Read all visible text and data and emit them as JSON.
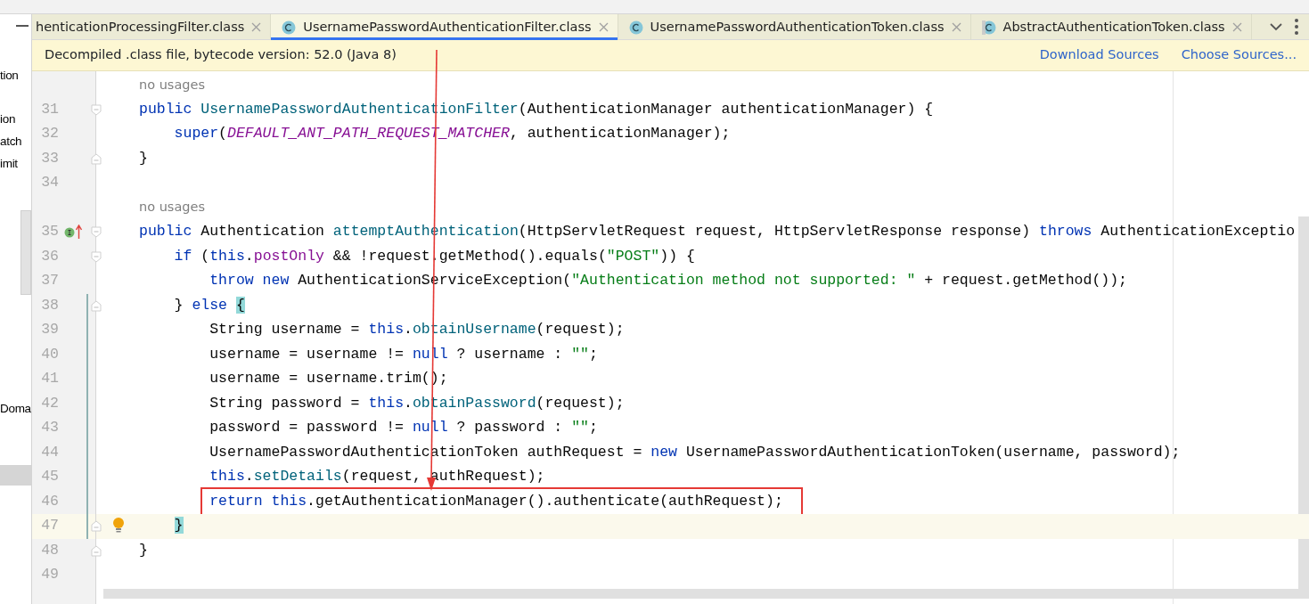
{
  "project_tree": [
    {
      "label": "tion",
      "selected": false
    },
    {
      "label": "ion",
      "selected": false
    },
    {
      "label": "atch",
      "selected": false
    },
    {
      "label": "imit",
      "selected": false
    },
    {
      "label": "Doma",
      "selected": false
    }
  ],
  "tabs": [
    {
      "label": "henticationProcessingFilter.class",
      "selected": false,
      "kind": "partial"
    },
    {
      "label": "UsernamePasswordAuthenticationFilter.class",
      "selected": true,
      "kind": "class"
    },
    {
      "label": "UsernamePasswordAuthenticationToken.class",
      "selected": false,
      "kind": "class"
    },
    {
      "label": "AbstractAuthenticationToken.class",
      "selected": false,
      "kind": "abstract"
    }
  ],
  "banner": {
    "text": "Decompiled .class file, bytecode version: 52.0 (Java 8)",
    "links": [
      "Download Sources",
      "Choose Sources..."
    ]
  },
  "code": [
    {
      "kind": "hint",
      "text": "no usages"
    },
    {
      "kind": "line",
      "number": "31",
      "fold_start": true,
      "tokens": [
        {
          "kind": "keyword",
          "text": "public "
        },
        {
          "kind": "declaration",
          "text": "UsernamePasswordAuthenticationFilter"
        },
        {
          "kind": "plain",
          "text": "(AuthenticationManager authenticationManager) {"
        }
      ],
      "children": [
        {
          "kind": "line",
          "number": "32",
          "tokens": [
            {
              "kind": "keyword",
              "text": "super"
            },
            {
              "kind": "plain",
              "text": "("
            },
            {
              "kind": "constant",
              "text": "DEFAULT_ANT_PATH_REQUEST_MATCHER"
            },
            {
              "kind": "plain",
              "text": ", authenticationManager);"
            }
          ]
        }
      ]
    },
    {
      "kind": "line",
      "number": "33",
      "fold_end": true,
      "tokens": [
        {
          "kind": "plain",
          "text": "}"
        }
      ]
    },
    {
      "kind": "line",
      "number": "34"
    },
    {
      "kind": "hint",
      "text": "no usages"
    },
    {
      "kind": "line",
      "number": "35",
      "fold_start": true,
      "implements": true,
      "tokens": [
        {
          "kind": "keyword",
          "text": "public "
        },
        {
          "kind": "plain",
          "text": "Authentication "
        },
        {
          "kind": "declaration",
          "text": "attemptAuthentication"
        },
        {
          "kind": "plain",
          "text": "(HttpServletRequest request, HttpServletResponse response) "
        },
        {
          "kind": "keyword",
          "text": "throws "
        },
        {
          "kind": "plain",
          "text": "AuthenticationExceptio"
        }
      ],
      "children": [
        {
          "kind": "line",
          "number": "36",
          "fold_start": true,
          "tokens": [
            {
              "kind": "keyword",
              "text": "if "
            },
            {
              "kind": "plain",
              "text": "("
            },
            {
              "kind": "keyword",
              "text": "this"
            },
            {
              "kind": "plain",
              "text": "."
            },
            {
              "kind": "field",
              "text": "postOnly"
            },
            {
              "kind": "plain",
              "text": " && !request.getMethod().equals("
            },
            {
              "kind": "string",
              "text": "\"POST\""
            },
            {
              "kind": "plain",
              "text": ")) {"
            }
          ],
          "children": [
            {
              "kind": "line",
              "number": "37",
              "tokens": [
                {
                  "kind": "keyword",
                  "text": "throw new "
                },
                {
                  "kind": "plain",
                  "text": "AuthenticationServiceException("
                },
                {
                  "kind": "string",
                  "text": "\"Authentication method not supported: \""
                },
                {
                  "kind": "plain",
                  "text": " + request.getMethod());"
                }
              ]
            }
          ]
        },
        {
          "kind": "line",
          "number": "38",
          "fold_end": true,
          "modified": true,
          "tokens": [
            {
              "kind": "plain",
              "text": "} "
            },
            {
              "kind": "keyword",
              "text": "else "
            },
            {
              "kind": "brace",
              "text": "{"
            }
          ],
          "children": [
            {
              "kind": "line",
              "number": "39",
              "modified": true,
              "tokens": [
                {
                  "kind": "plain",
                  "text": "String username = "
                },
                {
                  "kind": "keyword",
                  "text": "this"
                },
                {
                  "kind": "plain",
                  "text": "."
                },
                {
                  "kind": "call",
                  "text": "obtainUsername"
                },
                {
                  "kind": "plain",
                  "text": "(request);"
                }
              ]
            },
            {
              "kind": "line",
              "number": "40",
              "modified": true,
              "tokens": [
                {
                  "kind": "plain",
                  "text": "username = username != "
                },
                {
                  "kind": "keyword",
                  "text": "null"
                },
                {
                  "kind": "plain",
                  "text": " ? username : "
                },
                {
                  "kind": "string",
                  "text": "\"\""
                },
                {
                  "kind": "plain",
                  "text": ";"
                }
              ]
            },
            {
              "kind": "line",
              "number": "41",
              "modified": true,
              "tokens": [
                {
                  "kind": "plain",
                  "text": "username = username.trim();"
                }
              ]
            },
            {
              "kind": "line",
              "number": "42",
              "modified": true,
              "tokens": [
                {
                  "kind": "plain",
                  "text": "String password = "
                },
                {
                  "kind": "keyword",
                  "text": "this"
                },
                {
                  "kind": "plain",
                  "text": "."
                },
                {
                  "kind": "call",
                  "text": "obtainPassword"
                },
                {
                  "kind": "plain",
                  "text": "(request);"
                }
              ]
            },
            {
              "kind": "line",
              "number": "43",
              "modified": true,
              "tokens": [
                {
                  "kind": "plain",
                  "text": "password = password != "
                },
                {
                  "kind": "keyword",
                  "text": "null"
                },
                {
                  "kind": "plain",
                  "text": " ? password : "
                },
                {
                  "kind": "string",
                  "text": "\"\""
                },
                {
                  "kind": "plain",
                  "text": ";"
                }
              ]
            },
            {
              "kind": "line",
              "number": "44",
              "modified": true,
              "tokens": [
                {
                  "kind": "plain",
                  "text": "UsernamePasswordAuthenticationToken authRequest = "
                },
                {
                  "kind": "keyword",
                  "text": "new "
                },
                {
                  "kind": "plain",
                  "text": "UsernamePasswordAuthenticationToken(username, password);"
                }
              ]
            },
            {
              "kind": "line",
              "number": "45",
              "modified": true,
              "tokens": [
                {
                  "kind": "keyword",
                  "text": "this"
                },
                {
                  "kind": "plain",
                  "text": "."
                },
                {
                  "kind": "call",
                  "text": "setDetails"
                },
                {
                  "kind": "plain",
                  "text": "(request, authRequest);"
                }
              ]
            },
            {
              "kind": "line",
              "number": "46",
              "modified": true,
              "boxed": true,
              "tokens": [
                {
                  "kind": "keyword",
                  "text": "return "
                },
                {
                  "kind": "keyword",
                  "text": "this"
                },
                {
                  "kind": "plain",
                  "text": ".getAuthenticationManager().authenticate(authRequest);"
                }
              ]
            }
          ]
        },
        {
          "kind": "line",
          "number": "47",
          "fold_end": true,
          "modified": true,
          "current": true,
          "bulb": true,
          "tokens": [
            {
              "kind": "brace",
              "text": "}"
            }
          ]
        }
      ]
    },
    {
      "kind": "line",
      "number": "48",
      "fold_end": true,
      "tokens": [
        {
          "kind": "plain",
          "text": "}"
        }
      ]
    },
    {
      "kind": "line",
      "number": "49"
    }
  ]
}
